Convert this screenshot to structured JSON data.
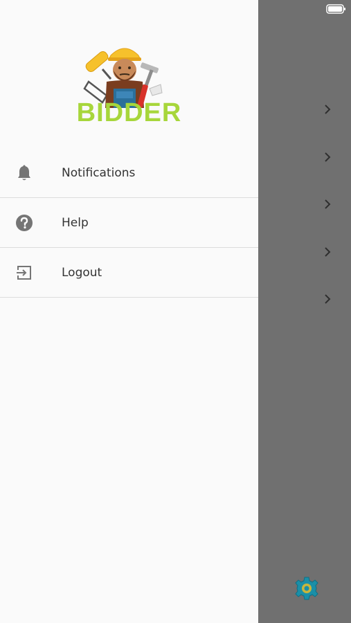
{
  "app": {
    "brand_name": "BIDDER",
    "status_time": ""
  },
  "drawer": {
    "items": [
      {
        "label": "Notifications",
        "icon": "bell-icon"
      },
      {
        "label": "Help",
        "icon": "help-circle-icon"
      },
      {
        "label": "Logout",
        "icon": "logout-icon"
      }
    ]
  },
  "background": {
    "row_count": 5,
    "row_icon": "chevron-right-icon",
    "fab_icon": "gear-icon"
  },
  "colors": {
    "brand_green": "#a7d63b",
    "drawer_bg": "#fafafa",
    "backdrop": "#707070",
    "gear_teal": "#1a8fa8",
    "gear_yellow": "#c9b53b"
  }
}
